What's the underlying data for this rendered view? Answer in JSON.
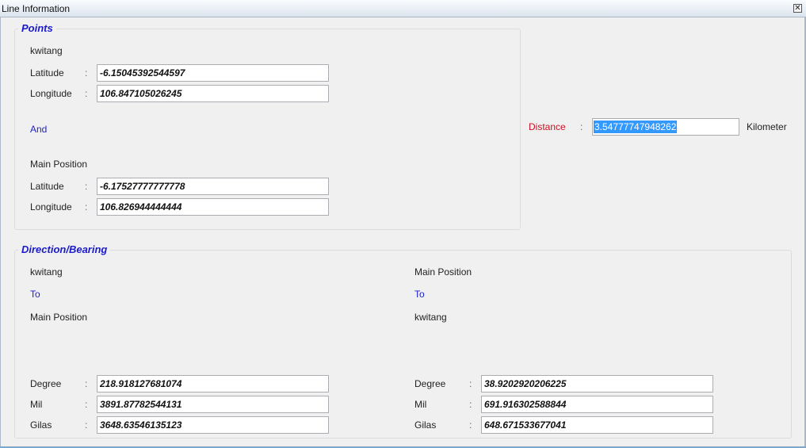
{
  "window": {
    "title": "Line Information"
  },
  "points": {
    "legend": "Points",
    "point_a_name": "kwitang",
    "latitude_label": "Latitude",
    "longitude_label": "Longitude",
    "colon": ":",
    "point_a_latitude": "-6.15045392544597",
    "point_a_longitude": "106.847105026245",
    "and_label": "And",
    "point_b_name": "Main Position",
    "point_b_latitude": "-6.17527777777778",
    "point_b_longitude": "106.826944444444"
  },
  "distance": {
    "label": "Distance",
    "colon": ":",
    "value": "3.54777747948262",
    "unit": "Kilometer"
  },
  "bearing": {
    "legend": "Direction/Bearing",
    "to_label": "To",
    "degree_label": "Degree",
    "mil_label": "Mil",
    "gilas_label": "Gilas",
    "colon": ":",
    "left": {
      "from": "kwitang",
      "to": "Main Position",
      "degree": "218.918127681074",
      "mil": "3891.87782544131",
      "gilas": "3648.63546135123"
    },
    "right": {
      "from": "Main Position",
      "to": "kwitang",
      "degree": "38.9202920206225",
      "mil": "691.916302588844",
      "gilas": "648.671533677041"
    }
  }
}
